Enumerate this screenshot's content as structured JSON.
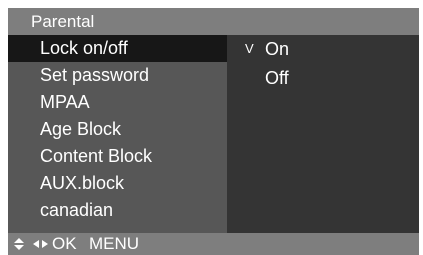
{
  "title": "Parental",
  "menu": {
    "items": [
      {
        "label": "Lock on/off",
        "selected": true
      },
      {
        "label": "Set password",
        "selected": false
      },
      {
        "label": "MPAA",
        "selected": false
      },
      {
        "label": "Age Block",
        "selected": false
      },
      {
        "label": "Content Block",
        "selected": false
      },
      {
        "label": "AUX.block",
        "selected": false
      },
      {
        "label": "canadian",
        "selected": false
      }
    ]
  },
  "options": {
    "check_mark": "V",
    "items": [
      {
        "label": "On",
        "checked": true
      },
      {
        "label": "Off",
        "checked": false
      }
    ]
  },
  "help": {
    "icons": [
      "up-down-arrow-icon",
      "left-right-arrow-icon"
    ],
    "ok_label": "OK",
    "menu_label": "MENU"
  },
  "colors": {
    "title_bar": "#7e7e7e",
    "menu_panel": "#575757",
    "selected_row": "#171717",
    "options_panel": "#343434",
    "text": "#ffffff"
  }
}
